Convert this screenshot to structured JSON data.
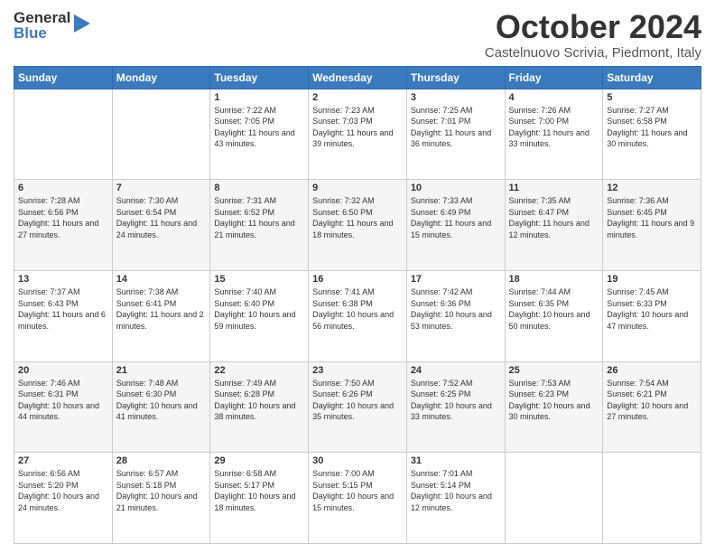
{
  "header": {
    "logo_line1": "General",
    "logo_line2": "Blue",
    "month_title": "October 2024",
    "location": "Castelnuovo Scrivia, Piedmont, Italy"
  },
  "weekdays": [
    "Sunday",
    "Monday",
    "Tuesday",
    "Wednesday",
    "Thursday",
    "Friday",
    "Saturday"
  ],
  "weeks": [
    [
      {
        "day": "",
        "info": ""
      },
      {
        "day": "",
        "info": ""
      },
      {
        "day": "1",
        "info": "Sunrise: 7:22 AM\nSunset: 7:05 PM\nDaylight: 11 hours and 43 minutes."
      },
      {
        "day": "2",
        "info": "Sunrise: 7:23 AM\nSunset: 7:03 PM\nDaylight: 11 hours and 39 minutes."
      },
      {
        "day": "3",
        "info": "Sunrise: 7:25 AM\nSunset: 7:01 PM\nDaylight: 11 hours and 36 minutes."
      },
      {
        "day": "4",
        "info": "Sunrise: 7:26 AM\nSunset: 7:00 PM\nDaylight: 11 hours and 33 minutes."
      },
      {
        "day": "5",
        "info": "Sunrise: 7:27 AM\nSunset: 6:58 PM\nDaylight: 11 hours and 30 minutes."
      }
    ],
    [
      {
        "day": "6",
        "info": "Sunrise: 7:28 AM\nSunset: 6:56 PM\nDaylight: 11 hours and 27 minutes."
      },
      {
        "day": "7",
        "info": "Sunrise: 7:30 AM\nSunset: 6:54 PM\nDaylight: 11 hours and 24 minutes."
      },
      {
        "day": "8",
        "info": "Sunrise: 7:31 AM\nSunset: 6:52 PM\nDaylight: 11 hours and 21 minutes."
      },
      {
        "day": "9",
        "info": "Sunrise: 7:32 AM\nSunset: 6:50 PM\nDaylight: 11 hours and 18 minutes."
      },
      {
        "day": "10",
        "info": "Sunrise: 7:33 AM\nSunset: 6:49 PM\nDaylight: 11 hours and 15 minutes."
      },
      {
        "day": "11",
        "info": "Sunrise: 7:35 AM\nSunset: 6:47 PM\nDaylight: 11 hours and 12 minutes."
      },
      {
        "day": "12",
        "info": "Sunrise: 7:36 AM\nSunset: 6:45 PM\nDaylight: 11 hours and 9 minutes."
      }
    ],
    [
      {
        "day": "13",
        "info": "Sunrise: 7:37 AM\nSunset: 6:43 PM\nDaylight: 11 hours and 6 minutes."
      },
      {
        "day": "14",
        "info": "Sunrise: 7:38 AM\nSunset: 6:41 PM\nDaylight: 11 hours and 2 minutes."
      },
      {
        "day": "15",
        "info": "Sunrise: 7:40 AM\nSunset: 6:40 PM\nDaylight: 10 hours and 59 minutes."
      },
      {
        "day": "16",
        "info": "Sunrise: 7:41 AM\nSunset: 6:38 PM\nDaylight: 10 hours and 56 minutes."
      },
      {
        "day": "17",
        "info": "Sunrise: 7:42 AM\nSunset: 6:36 PM\nDaylight: 10 hours and 53 minutes."
      },
      {
        "day": "18",
        "info": "Sunrise: 7:44 AM\nSunset: 6:35 PM\nDaylight: 10 hours and 50 minutes."
      },
      {
        "day": "19",
        "info": "Sunrise: 7:45 AM\nSunset: 6:33 PM\nDaylight: 10 hours and 47 minutes."
      }
    ],
    [
      {
        "day": "20",
        "info": "Sunrise: 7:46 AM\nSunset: 6:31 PM\nDaylight: 10 hours and 44 minutes."
      },
      {
        "day": "21",
        "info": "Sunrise: 7:48 AM\nSunset: 6:30 PM\nDaylight: 10 hours and 41 minutes."
      },
      {
        "day": "22",
        "info": "Sunrise: 7:49 AM\nSunset: 6:28 PM\nDaylight: 10 hours and 38 minutes."
      },
      {
        "day": "23",
        "info": "Sunrise: 7:50 AM\nSunset: 6:26 PM\nDaylight: 10 hours and 35 minutes."
      },
      {
        "day": "24",
        "info": "Sunrise: 7:52 AM\nSunset: 6:25 PM\nDaylight: 10 hours and 33 minutes."
      },
      {
        "day": "25",
        "info": "Sunrise: 7:53 AM\nSunset: 6:23 PM\nDaylight: 10 hours and 30 minutes."
      },
      {
        "day": "26",
        "info": "Sunrise: 7:54 AM\nSunset: 6:21 PM\nDaylight: 10 hours and 27 minutes."
      }
    ],
    [
      {
        "day": "27",
        "info": "Sunrise: 6:56 AM\nSunset: 5:20 PM\nDaylight: 10 hours and 24 minutes."
      },
      {
        "day": "28",
        "info": "Sunrise: 6:57 AM\nSunset: 5:18 PM\nDaylight: 10 hours and 21 minutes."
      },
      {
        "day": "29",
        "info": "Sunrise: 6:58 AM\nSunset: 5:17 PM\nDaylight: 10 hours and 18 minutes."
      },
      {
        "day": "30",
        "info": "Sunrise: 7:00 AM\nSunset: 5:15 PM\nDaylight: 10 hours and 15 minutes."
      },
      {
        "day": "31",
        "info": "Sunrise: 7:01 AM\nSunset: 5:14 PM\nDaylight: 10 hours and 12 minutes."
      },
      {
        "day": "",
        "info": ""
      },
      {
        "day": "",
        "info": ""
      }
    ]
  ]
}
